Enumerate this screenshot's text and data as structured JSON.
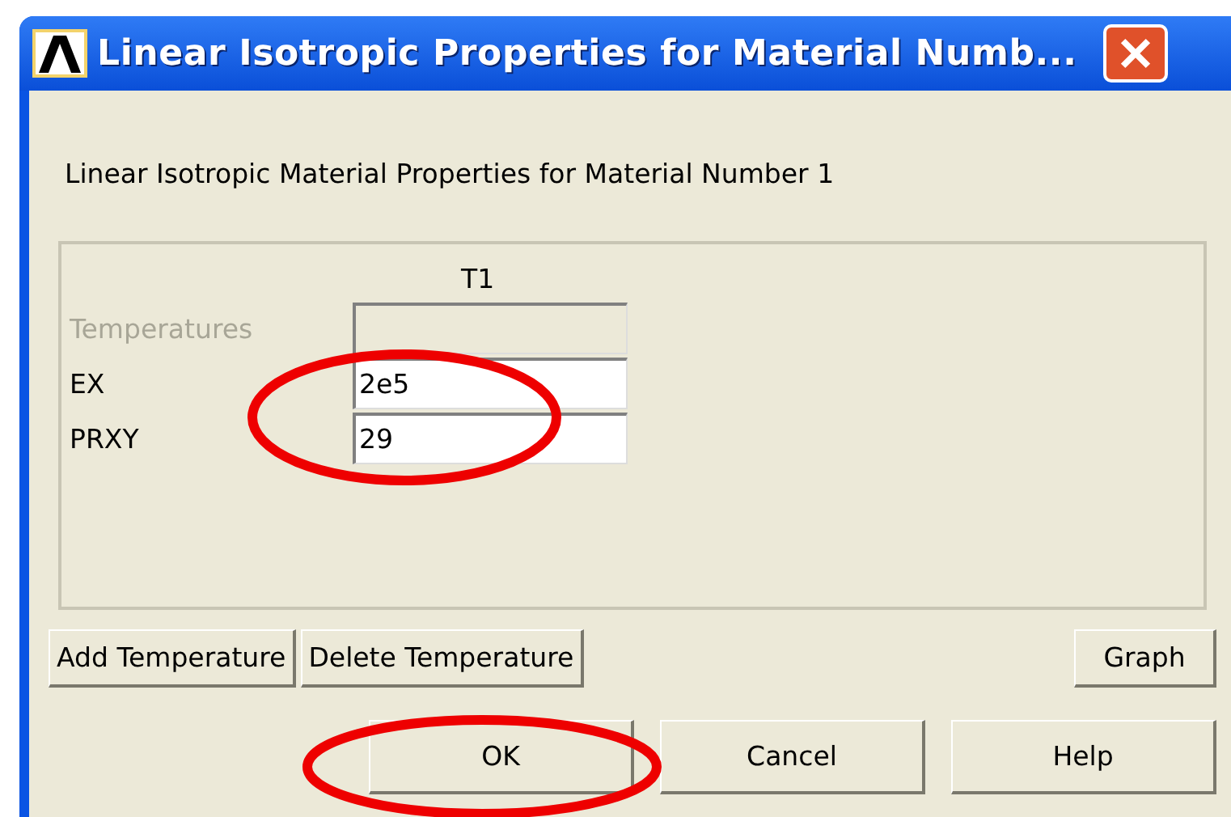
{
  "window": {
    "title": "Linear Isotropic Properties for Material Numb..."
  },
  "heading": "Linear Isotropic Material Properties for Material Number 1",
  "table": {
    "column": "T1",
    "rows": [
      {
        "label": "Temperatures",
        "disabled": true
      },
      {
        "label": "EX",
        "value": "2e5",
        "disabled": false
      },
      {
        "label": "PRXY",
        "value": "29",
        "disabled": false
      }
    ]
  },
  "table_buttons": [
    "Add Temperature",
    "Delete Temperature"
  ],
  "graph_button": "Graph",
  "dialog_buttons": [
    "OK",
    "Cancel",
    "Help"
  ]
}
